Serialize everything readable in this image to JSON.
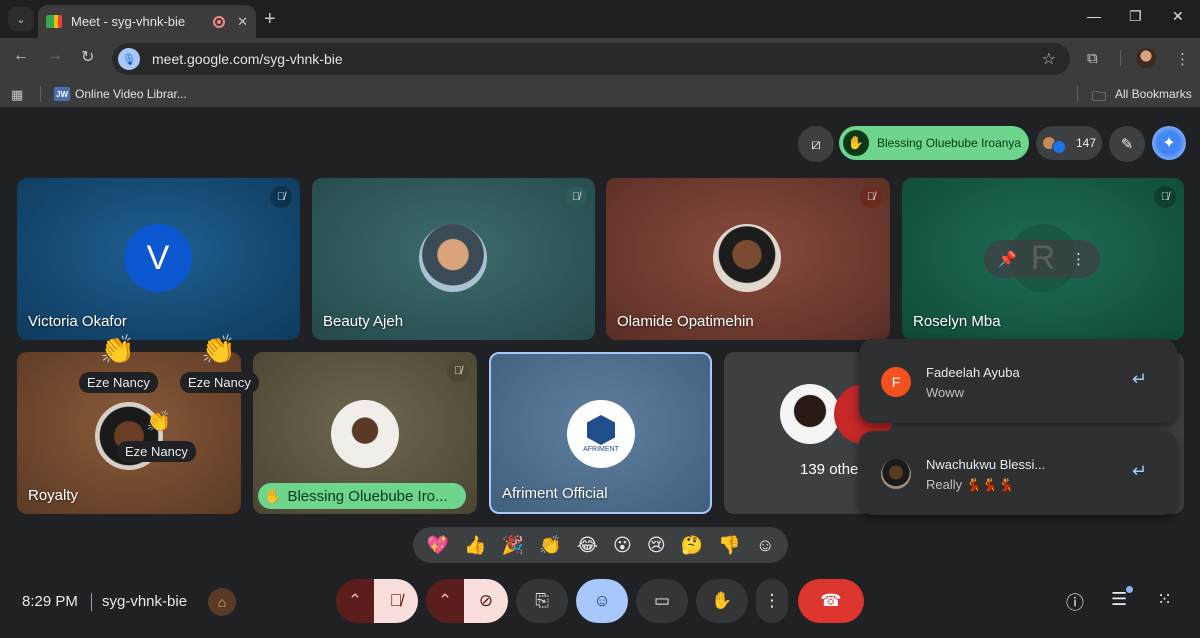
{
  "browser": {
    "tab_title": "Meet - syg-vhnk-bie",
    "url": "meet.google.com/syg-vhnk-bie",
    "bookmark": "Online Video Librar...",
    "bookmark_favicon": "JW",
    "all_bookmarks": "All Bookmarks"
  },
  "meet": {
    "hand_raised_name": "Blessing Oluebube Iroanya",
    "participant_count": "147",
    "tiles": [
      {
        "name": "Victoria Okafor",
        "initial": "V"
      },
      {
        "name": "Beauty Ajeh"
      },
      {
        "name": "Olamide Opatimehin"
      },
      {
        "name": "Roselyn Mba",
        "initial": "R"
      },
      {
        "name": "Royalty"
      },
      {
        "name": "Blessing Oluebube Iro..."
      },
      {
        "name": "Afriment Official",
        "logo_text": "AFRIMENT"
      },
      {
        "name": "139 othe"
      }
    ],
    "reactions": [
      "Eze Nancy",
      "Eze Nancy",
      "Eze Nancy"
    ],
    "chat": [
      {
        "from": "Fadeelah Ayuba",
        "initial": "F",
        "message": "Woww",
        "color": "#f4511e"
      },
      {
        "from": "Nwachukwu Blessi...",
        "message": "Really 💃💃💃"
      }
    ],
    "emojis": [
      "💖",
      "👍",
      "🎉",
      "👏",
      "😂",
      "😮",
      "😢",
      "🤔",
      "👎"
    ],
    "time": "8:29 PM",
    "meeting_code": "syg-vhnk-bie"
  },
  "colors": {
    "hand_green": "#6dd58c",
    "end_call_red": "#dc362e",
    "selected_blue": "#a8c7fa"
  }
}
